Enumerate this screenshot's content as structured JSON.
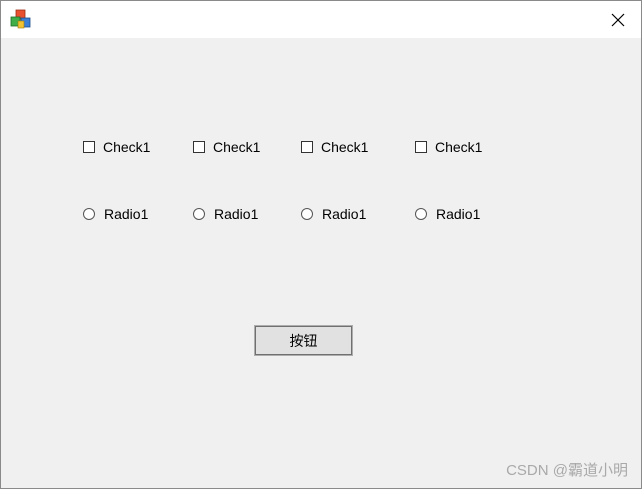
{
  "window": {
    "close_glyph": "close-icon",
    "app_icon": "mfc-app-icon"
  },
  "checkboxes": [
    {
      "label": "Check1",
      "checked": false
    },
    {
      "label": "Check1",
      "checked": false
    },
    {
      "label": "Check1",
      "checked": false
    },
    {
      "label": "Check1",
      "checked": false
    }
  ],
  "radios": [
    {
      "label": "Radio1",
      "selected": false
    },
    {
      "label": "Radio1",
      "selected": false
    },
    {
      "label": "Radio1",
      "selected": false
    },
    {
      "label": "Radio1",
      "selected": false
    }
  ],
  "button": {
    "label": "按钮"
  },
  "watermark": {
    "text": "CSDN @霸道小明"
  },
  "colors": {
    "client_bg": "#f0f0f0",
    "titlebar_bg": "#ffffff",
    "button_bg": "#e1e1e1"
  }
}
